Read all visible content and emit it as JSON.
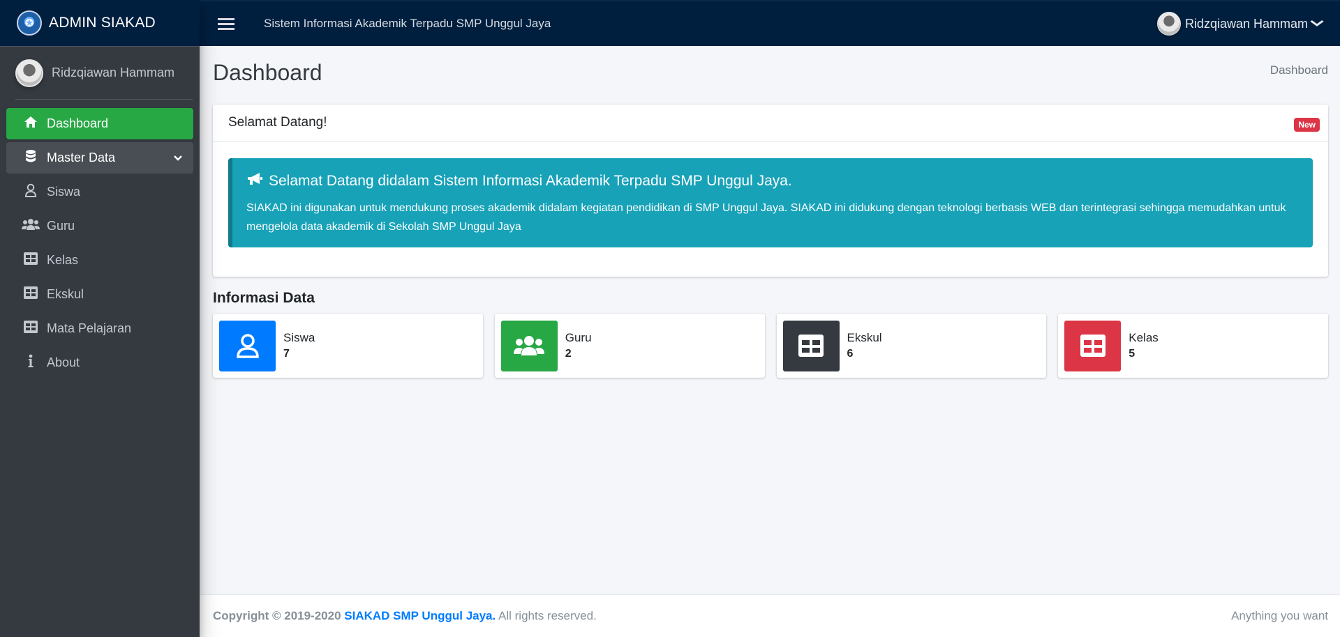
{
  "brand": {
    "name": "ADMIN SIAKAD"
  },
  "topbar": {
    "title": "Sistem Informasi Akademik Terpadu SMP Unggul Jaya",
    "user_name": "Ridzqiawan Hammam"
  },
  "sidebar": {
    "user_name": "Ridzqiawan Hammam",
    "items": [
      {
        "label": "Dashboard",
        "icon": "home-icon"
      },
      {
        "label": "Master Data",
        "icon": "database-icon"
      },
      {
        "label": "Siswa",
        "icon": "user-icon"
      },
      {
        "label": "Guru",
        "icon": "users-icon"
      },
      {
        "label": "Kelas",
        "icon": "table-icon"
      },
      {
        "label": "Ekskul",
        "icon": "table-icon"
      },
      {
        "label": "Mata Pelajaran",
        "icon": "table-icon"
      },
      {
        "label": "About",
        "icon": "info-icon"
      }
    ]
  },
  "page": {
    "title": "Dashboard",
    "breadcrumb": "Dashboard"
  },
  "welcome_card": {
    "title": "Selamat Datang!",
    "badge": "New",
    "callout_title": "Selamat Datang didalam Sistem Informasi Akademik Terpadu SMP Unggul Jaya.",
    "callout_text": "SIAKAD ini digunakan untuk mendukung proses akademik didalam kegiatan pendidikan di SMP Unggul Jaya. SIAKAD ini didukung dengan teknologi berbasis WEB dan terintegrasi sehingga memudahkan untuk mengelola data akademik di Sekolah SMP Unggul Jaya"
  },
  "info": {
    "title": "Informasi Data",
    "boxes": [
      {
        "label": "Siswa",
        "value": "7",
        "icon": "user-icon",
        "color": "#007bff"
      },
      {
        "label": "Guru",
        "value": "2",
        "icon": "users-icon",
        "color": "#28a745"
      },
      {
        "label": "Ekskul",
        "value": "6",
        "icon": "table-icon",
        "color": "#343a40"
      },
      {
        "label": "Kelas",
        "value": "5",
        "icon": "table-icon",
        "color": "#dc3545"
      }
    ]
  },
  "footer": {
    "copyright": "Copyright © 2019-2020",
    "org": "SIAKAD SMP Unggul Jaya.",
    "rights": "All rights reserved.",
    "right_text": "Anything you want"
  },
  "colors": {
    "navbar": "#001f3f",
    "sidebar": "#343a40",
    "active": "#28a745",
    "callout": "#17a2b8"
  }
}
